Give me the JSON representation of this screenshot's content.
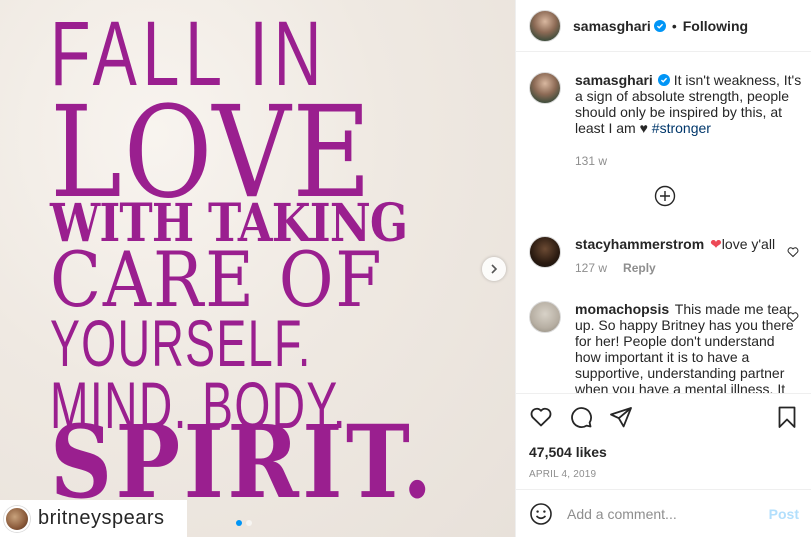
{
  "post": {
    "author": "samasghari",
    "follow_status": "Following",
    "separator": "•",
    "image": {
      "quote_lines": [
        "FALL IN",
        "LOVE",
        "WITH TAKING",
        "CARE OF",
        "YOURSELF.",
        "MIND. BODY.",
        "SPIRIT."
      ],
      "tagged_user": "britneyspears",
      "carousel_count": 2,
      "carousel_active": 1,
      "text_color": "#9a1f8f"
    },
    "caption": {
      "username": "samasghari",
      "text": "It isn't weakness, It's a sign of absolute strength, people should only be inspired by this, at least I am ♥",
      "hashtag": "#stronger",
      "time_ago": "131 w"
    },
    "comments": [
      {
        "username": "stacyhammerstrom",
        "emoji": "❤",
        "text": "love y'all",
        "time_ago": "127 w",
        "reply_label": "Reply"
      },
      {
        "username": "momachopsis",
        "text": "This made me tear up. So happy Britney has you there for her! People don't understand how important it is to have a supportive, understanding partner when you have a mental illness. It"
      }
    ],
    "likes": "47,504 likes",
    "date": "APRIL 4, 2019",
    "add_comment": {
      "placeholder": "Add a comment...",
      "post_label": "Post"
    },
    "icons": {
      "header_avatar": "avatar",
      "verified": "verified-badge-icon",
      "next": "chevron-right-icon",
      "more": "plus-circle-icon",
      "like": "heart-icon",
      "comment": "comment-bubble-icon",
      "share": "paper-plane-icon",
      "save": "bookmark-icon",
      "emoji": "smiley-icon"
    },
    "colors": {
      "link": "#00376b",
      "verified": "#0095f6",
      "post_disabled": "#b2dffc",
      "heart": "#ed4956"
    }
  }
}
